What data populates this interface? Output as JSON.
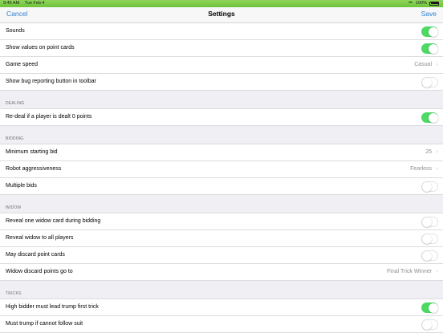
{
  "status": {
    "time": "9:45 AM",
    "date": "Tue Feb 4",
    "battery": "100%"
  },
  "nav": {
    "cancel": "Cancel",
    "title": "Settings",
    "save": "Save"
  },
  "colors": {
    "accent": "#2d7fd2",
    "toggle_on": "#4cd964"
  },
  "general": [
    {
      "label": "Sounds",
      "type": "toggle",
      "on": true
    },
    {
      "label": "Show values on point cards",
      "type": "toggle",
      "on": true
    },
    {
      "label": "Game speed",
      "type": "value",
      "value": "Casual"
    },
    {
      "label": "Show bug reporting button in toolbar",
      "type": "toggle",
      "on": false
    }
  ],
  "dealing": {
    "header": "DEALING",
    "rows": [
      {
        "label": "Re-deal if a player is dealt 0 points",
        "type": "toggle",
        "on": true
      }
    ]
  },
  "bidding": {
    "header": "BIDDING",
    "rows": [
      {
        "label": "Minimum starting bid",
        "type": "value",
        "value": "25"
      },
      {
        "label": "Robot aggressiveness",
        "type": "value",
        "value": "Fearless"
      },
      {
        "label": "Multiple bids",
        "type": "toggle",
        "on": false
      }
    ]
  },
  "widow": {
    "header": "WIDOW",
    "rows": [
      {
        "label": "Reveal one widow card during bidding",
        "type": "toggle",
        "on": false
      },
      {
        "label": "Reveal widow to all players",
        "type": "toggle",
        "on": false
      },
      {
        "label": "May discard point cards",
        "type": "toggle",
        "on": false
      },
      {
        "label": "Widow discard points go to",
        "type": "value",
        "value": "Final Trick Winner"
      }
    ]
  },
  "tricks": {
    "header": "TRICKS",
    "rows": [
      {
        "label": "High bidder must lead trump first trick",
        "type": "toggle",
        "on": true
      },
      {
        "label": "Must trump if cannot follow suit",
        "type": "toggle",
        "on": false
      }
    ]
  }
}
